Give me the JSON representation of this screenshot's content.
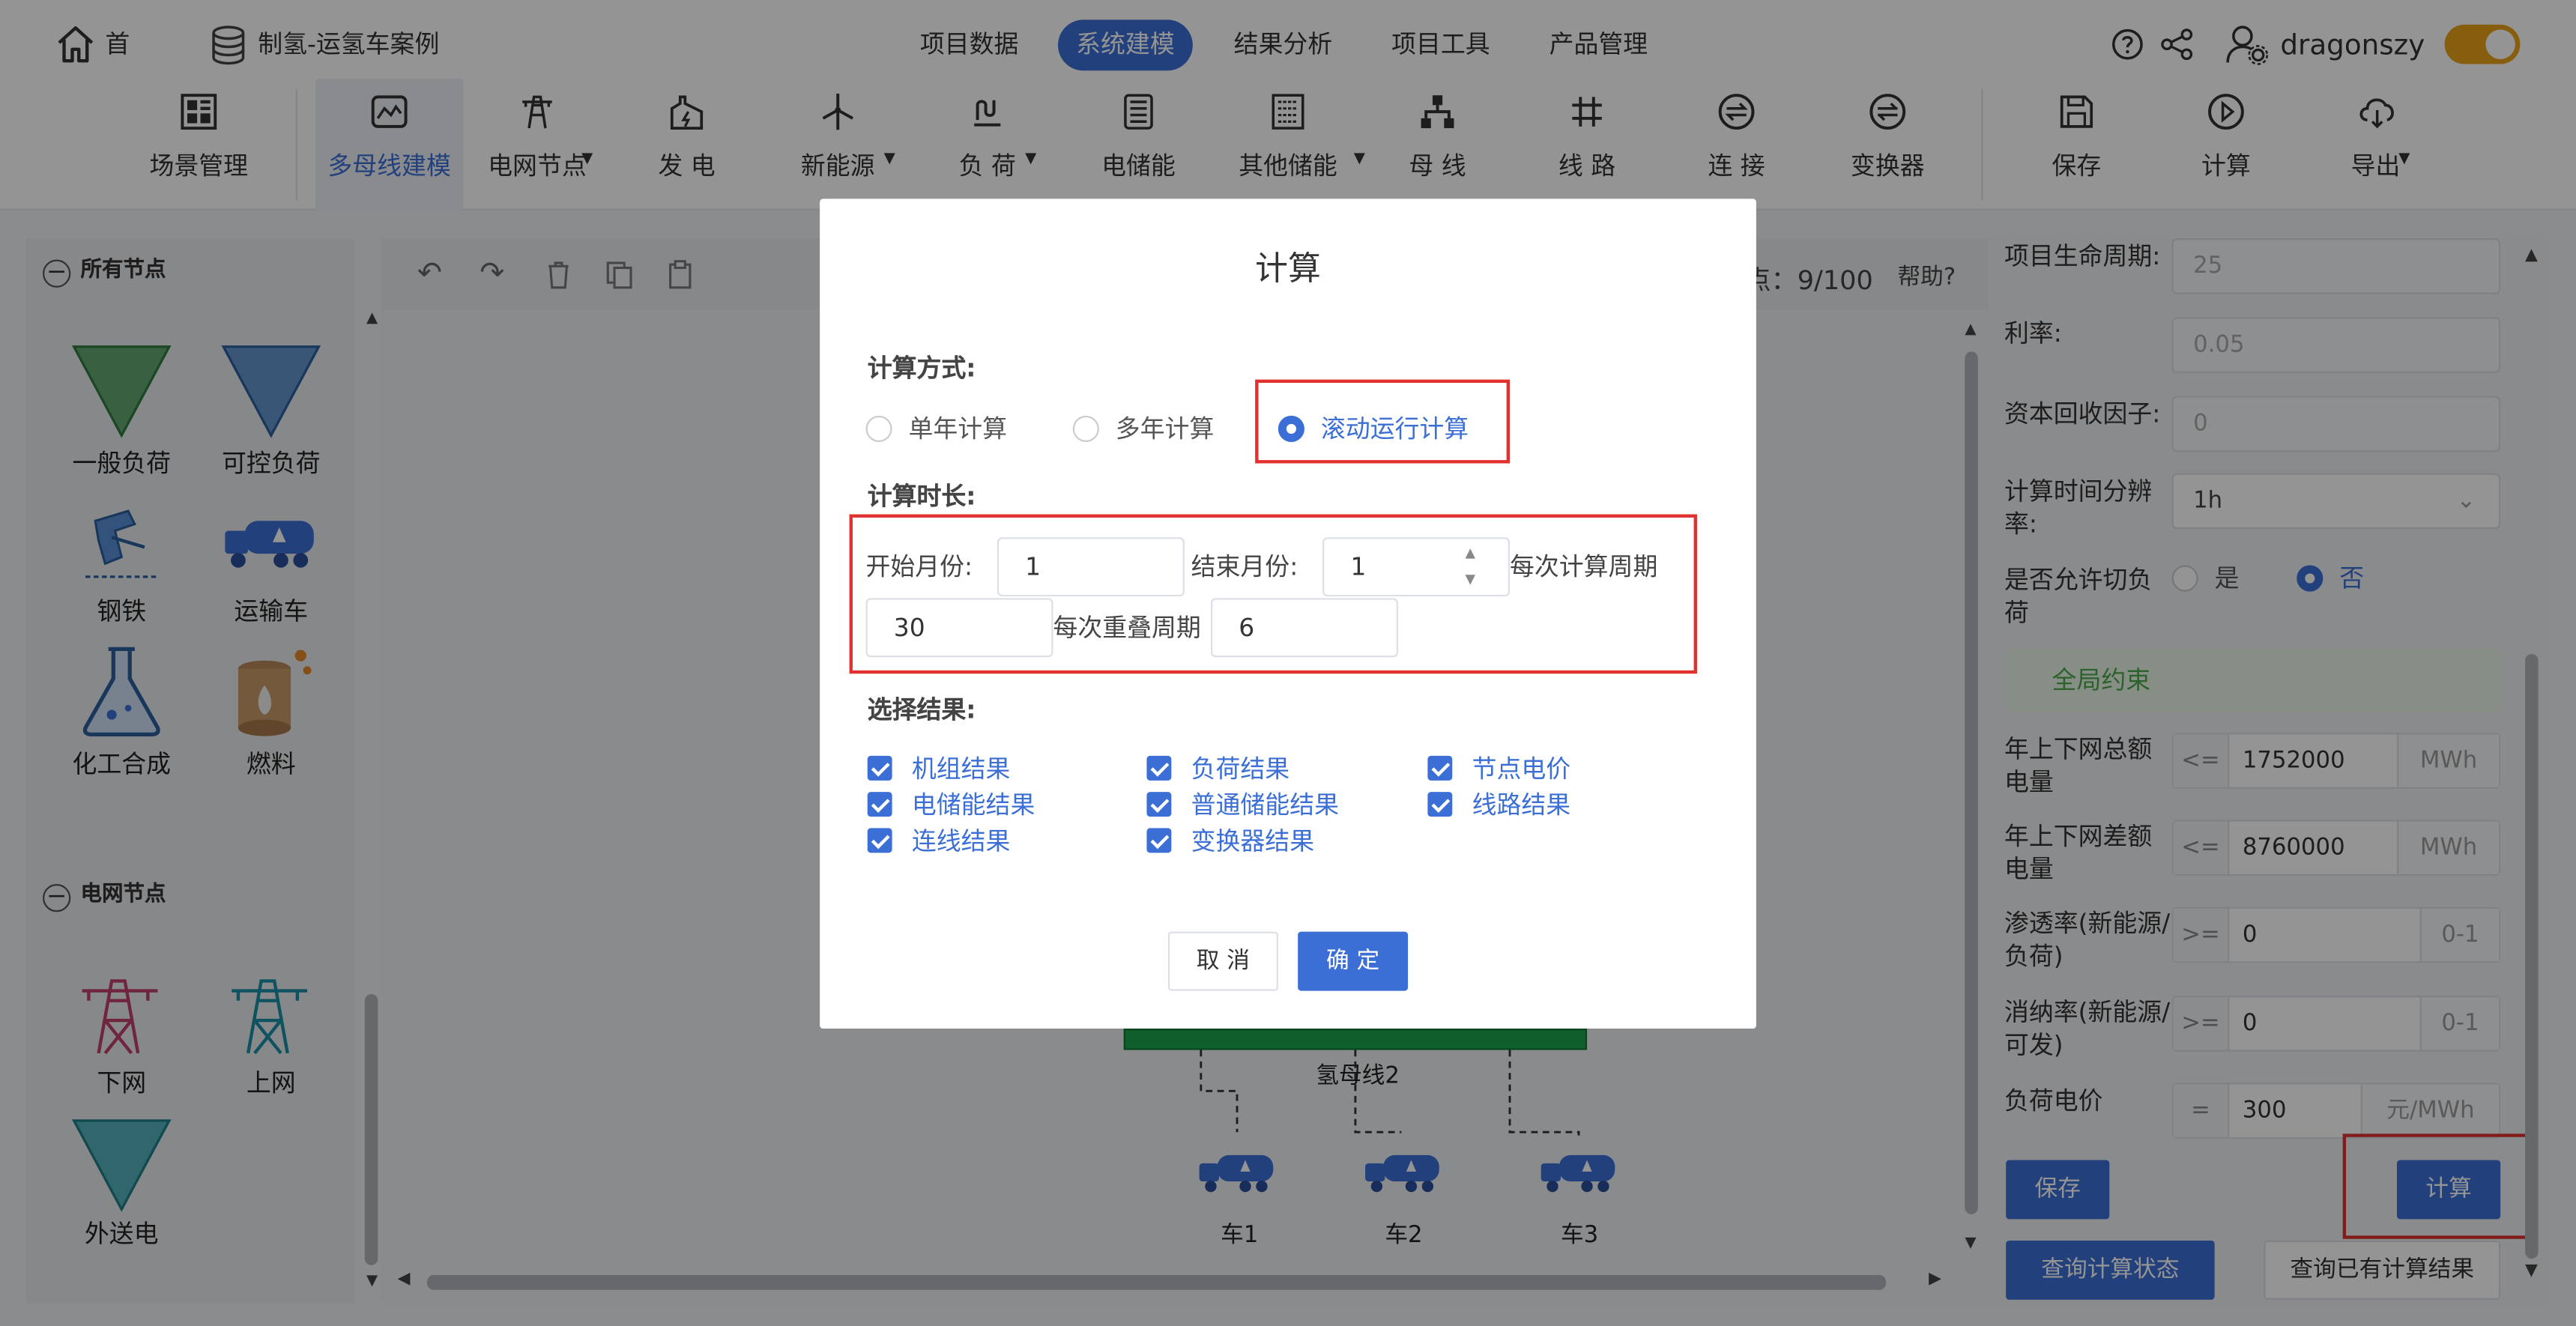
{
  "topnav": {
    "home": "首页",
    "project": "制氢-运氢车案例",
    "tabs": [
      "项目数据",
      "系统建模",
      "结果分析",
      "项目工具",
      "产品管理"
    ],
    "active_tab": "系统建模",
    "username": "dragonszy"
  },
  "toolbar": {
    "items": [
      {
        "label": "场景管理",
        "icon": "scene-icon"
      },
      {
        "label": "多母线建模",
        "icon": "multibus-icon"
      },
      {
        "label": "电网节点",
        "icon": "grid-tower-icon"
      },
      {
        "label": "发 电",
        "icon": "generator-icon"
      },
      {
        "label": "新能源",
        "icon": "wind-turbine-icon"
      },
      {
        "label": "负 荷",
        "icon": "load-icon"
      },
      {
        "label": "电储能",
        "icon": "battery-icon"
      },
      {
        "label": "其他储能",
        "icon": "storage-icon"
      },
      {
        "label": "母 线",
        "icon": "bus-icon"
      },
      {
        "label": "线 路",
        "icon": "line-icon"
      },
      {
        "label": "连 接",
        "icon": "connect-icon"
      },
      {
        "label": "变换器",
        "icon": "converter-icon"
      },
      {
        "label": "保存",
        "icon": "save-icon"
      },
      {
        "label": "计算",
        "icon": "play-icon"
      },
      {
        "label": "导出",
        "icon": "download-icon"
      }
    ]
  },
  "leftpanel": {
    "section1": "所有节点",
    "section2": "电网节点",
    "nodes1": [
      "一般负荷",
      "可控负荷",
      "钢铁",
      "运输车",
      "化工合成",
      "燃料"
    ],
    "nodes2": [
      "下网",
      "上网",
      "外送电"
    ]
  },
  "canvas": {
    "node_count": "点：9/100",
    "help": "帮助?",
    "bus_label": "氢母线2",
    "trucks": [
      "车1",
      "车2",
      "车3"
    ]
  },
  "rightpanel": {
    "lifecycle_label": "项目生命周期:",
    "lifecycle_value": "25",
    "rate_label": "利率:",
    "rate_value": "0.05",
    "crf_label": "资本回收因子:",
    "crf_value": "0",
    "resolution_label": "计算时间分辨率:",
    "resolution_value": "1h",
    "cut_load_label": "是否允许切负荷",
    "cut_load_yes": "是",
    "cut_load_no": "否",
    "global_constraint": "全局约束",
    "total_energy_label": "年上下网总额电量",
    "total_energy_op": "<=",
    "total_energy_value": "1752000",
    "total_energy_unit": "MWh",
    "diff_energy_label": "年上下网差额电量",
    "diff_energy_op": "<=",
    "diff_energy_value": "8760000",
    "diff_energy_unit": "MWh",
    "penetration_label": "渗透率(新能源/负荷)",
    "penetration_op": ">=",
    "penetration_value": "0",
    "penetration_unit": "0-1",
    "consumption_label": "消纳率(新能源/可发)",
    "consumption_op": ">=",
    "consumption_value": "0",
    "consumption_unit": "0-1",
    "load_price_label": "负荷电价",
    "load_price_op": "=",
    "load_price_value": "300",
    "load_price_unit": "元/MWh",
    "save_button": "保存",
    "calc_button": "计算",
    "query_status_button": "查询计算状态",
    "query_results_button": "查询已有计算结果"
  },
  "dialog": {
    "title": "计算",
    "method_label": "计算方式:",
    "methods": [
      "单年计算",
      "多年计算",
      "滚动运行计算"
    ],
    "selected_method": "滚动运行计算",
    "duration_label": "计算时长:",
    "start_month_label": "开始月份:",
    "start_month": "1",
    "end_month_label": "结束月份:",
    "end_month": "1",
    "period_label": "每次计算周期",
    "period_value": "30",
    "overlap_label": "每次重叠周期",
    "overlap_value": "6",
    "results_label": "选择结果:",
    "results": [
      "机组结果",
      "负荷结果",
      "节点电价",
      "电储能结果",
      "普通储能结果",
      "线路结果",
      "连线结果",
      "变换器结果"
    ],
    "cancel": "取 消",
    "confirm": "确 定"
  },
  "colors": {
    "primary": "#3b6fd6",
    "highlight_red": "#e0312f",
    "bus_green": "#1aa34a",
    "toggle": "#e8a317"
  }
}
